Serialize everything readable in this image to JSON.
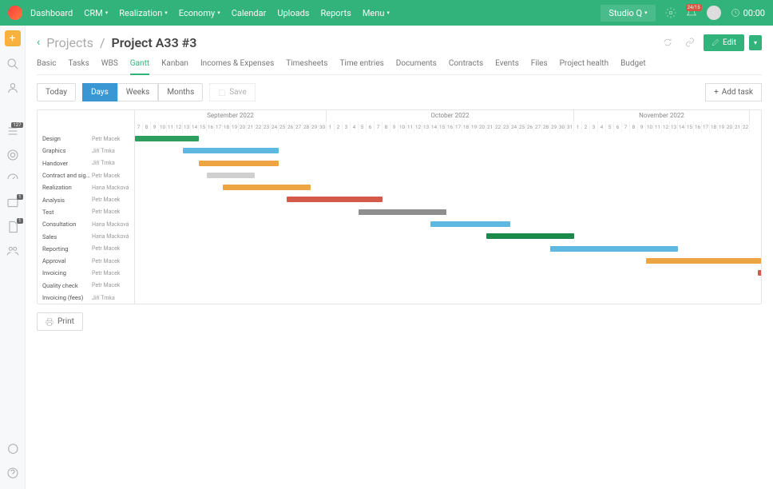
{
  "topnav": {
    "dashboard": "Dashboard",
    "crm": "CRM",
    "realization": "Realization",
    "economy": "Economy",
    "calendar": "Calendar",
    "uploads": "Uploads",
    "reports": "Reports",
    "menu": "Menu"
  },
  "studio": "Studio Q",
  "notif_badge": "24/15",
  "timer": "00:00",
  "breadcrumb": {
    "projects": "Projects",
    "title": "Project A33 #3"
  },
  "edit": "Edit",
  "tabs": [
    "Basic",
    "Tasks",
    "WBS",
    "Gantt",
    "Kanban",
    "Incomes & Expenses",
    "Timesheets",
    "Time entries",
    "Documents",
    "Contracts",
    "Events",
    "Files",
    "Project health",
    "Budget"
  ],
  "active_tab": "Gantt",
  "toolbar": {
    "today": "Today",
    "days": "Days",
    "weeks": "Weeks",
    "months": "Months",
    "save": "Save",
    "addtask": "Add task",
    "print": "Print"
  },
  "months": [
    {
      "label": "September 2022",
      "days": [
        "7",
        "8",
        "9",
        "10",
        "11",
        "12",
        "13",
        "14",
        "15",
        "16",
        "17",
        "18",
        "19",
        "20",
        "21",
        "22",
        "23",
        "24",
        "25",
        "26",
        "27",
        "28",
        "29",
        "30"
      ]
    },
    {
      "label": "October 2022",
      "days": [
        "1",
        "2",
        "3",
        "4",
        "5",
        "6",
        "7",
        "8",
        "9",
        "10",
        "11",
        "12",
        "13",
        "14",
        "15",
        "16",
        "17",
        "18",
        "19",
        "20",
        "21",
        "22",
        "23",
        "24",
        "25",
        "26",
        "27",
        "28",
        "29",
        "30",
        "31"
      ]
    },
    {
      "label": "November 2022",
      "days": [
        "1",
        "2",
        "3",
        "4",
        "5",
        "6",
        "7",
        "8",
        "9",
        "10",
        "11",
        "12",
        "13",
        "14",
        "15",
        "16",
        "17",
        "18",
        "19",
        "20",
        "21",
        "22"
      ]
    }
  ],
  "gantt": [
    {
      "name": "Design",
      "owner": "Petr Macek",
      "start": 0,
      "len": 8,
      "cls": "green"
    },
    {
      "name": "Graphics",
      "owner": "Jiří Trnka",
      "start": 6,
      "len": 12,
      "cls": "lightblue"
    },
    {
      "name": "Handover",
      "owner": "Jiří Trnka",
      "start": 8,
      "len": 10,
      "cls": "orange"
    },
    {
      "name": "Contract and signature",
      "owner": "Petr Macek",
      "start": 9,
      "len": 6,
      "cls": "lightgray"
    },
    {
      "name": "Realization",
      "owner": "Hana Macková",
      "start": 11,
      "len": 11,
      "cls": "orange"
    },
    {
      "name": "Analysis",
      "owner": "Petr Macek",
      "start": 19,
      "len": 12,
      "cls": "red"
    },
    {
      "name": "Test",
      "owner": "Petr Macek",
      "start": 28,
      "len": 11,
      "cls": "darkgray"
    },
    {
      "name": "Consultation",
      "owner": "Hana Macková",
      "start": 37,
      "len": 10,
      "cls": "lightblue"
    },
    {
      "name": "Sales",
      "owner": "Hana Macková",
      "start": 44,
      "len": 11,
      "cls": "darkgreen"
    },
    {
      "name": "Reporting",
      "owner": "Petr Macek",
      "start": 52,
      "len": 16,
      "cls": "lightblue"
    },
    {
      "name": "Approval",
      "owner": "Petr Macek",
      "start": 64,
      "len": 20,
      "cls": "orange"
    },
    {
      "name": "Invoicing",
      "owner": "Petr Macek",
      "start": 78,
      "len": 1,
      "cls": "tinyred"
    },
    {
      "name": "Quality check",
      "owner": "Petr Macek",
      "start": 0,
      "len": 0,
      "cls": ""
    },
    {
      "name": "Invoicing (fees)",
      "owner": "Jiří Trnka",
      "start": 0,
      "len": 0,
      "cls": ""
    }
  ],
  "side_badges": {
    "s1": "127",
    "s2": "1",
    "s3": "1"
  }
}
